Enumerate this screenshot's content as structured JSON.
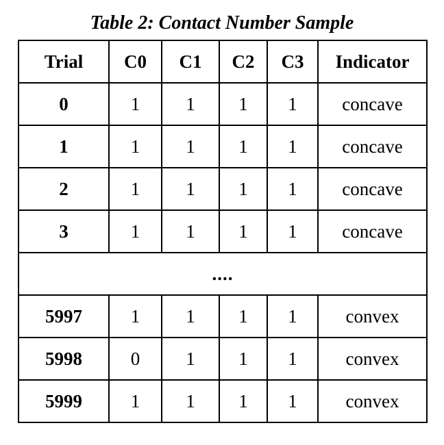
{
  "caption": "Table 2: Contact Number Sample",
  "table": {
    "headers": [
      "Trial",
      "C0",
      "C1",
      "C2",
      "C3",
      "Indicator"
    ],
    "rows_top": [
      {
        "trial": "0",
        "c0": "1",
        "c1": "1",
        "c2": "1",
        "c3": "1",
        "indicator": "concave"
      },
      {
        "trial": "1",
        "c0": "1",
        "c1": "1",
        "c2": "1",
        "c3": "1",
        "indicator": "concave"
      },
      {
        "trial": "2",
        "c0": "1",
        "c1": "1",
        "c2": "1",
        "c3": "1",
        "indicator": "concave"
      },
      {
        "trial": "3",
        "c0": "1",
        "c1": "1",
        "c2": "1",
        "c3": "1",
        "indicator": "concave"
      }
    ],
    "ellipsis": "....",
    "rows_bottom": [
      {
        "trial": "5997",
        "c0": "1",
        "c1": "1",
        "c2": "1",
        "c3": "1",
        "indicator": "convex"
      },
      {
        "trial": "5998",
        "c0": "0",
        "c1": "1",
        "c2": "1",
        "c3": "1",
        "indicator": "convex"
      },
      {
        "trial": "5999",
        "c0": "1",
        "c1": "1",
        "c2": "1",
        "c3": "1",
        "indicator": "convex"
      }
    ]
  }
}
